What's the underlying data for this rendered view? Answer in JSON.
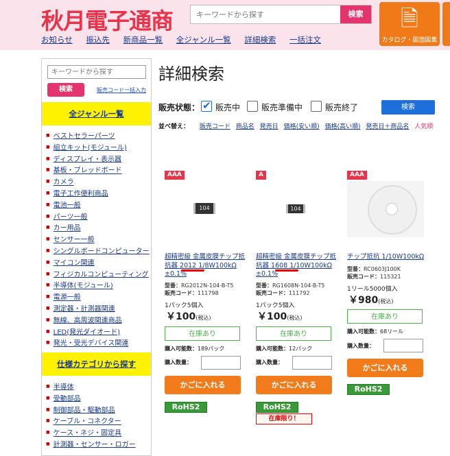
{
  "header": {
    "logo": "秋月電子通商",
    "search_placeholder": "キーワードから探す",
    "search_button": "検索",
    "catalog_label": "カタログ・図面図集",
    "nav": [
      "お知らせ",
      "振込先",
      "新商品一覧",
      "全ジャンル一覧",
      "詳細検索",
      "一括注文"
    ]
  },
  "sidebar": {
    "search_placeholder": "キーワードから探す",
    "search_button": "検索",
    "bulk_link": "販売コード一括入力",
    "genre_title": "全ジャンル一覧",
    "genres": [
      "ベストセラーパーツ",
      "組立キット(モジュール)",
      "ディスプレイ・表示器",
      "基板・ブレッドボード",
      "カメラ",
      "電子工作便利商品",
      "電池一般",
      "パーツ一般",
      "カー用品",
      "センサー一般",
      "シングルボードコンピューター",
      "マイコン関連",
      "フィジカルコンピューティング",
      "半導体(モジュール)",
      "電源一般",
      "測定器・計測器関連",
      "無線、高周波関連商品",
      "LED(発光ダイオード)",
      "発光・受光デバイス関連"
    ],
    "category_title": "仕様カテゴリから探す",
    "categories": [
      "半導体",
      "受動部品",
      "制御部品・駆動部品",
      "ケーブル・コネクター",
      "ケース・ネジ・固定具",
      "計測器・センサー・ロガー"
    ]
  },
  "main": {
    "title": "詳細検索",
    "status_label": "販売状態：",
    "status_options": [
      {
        "label": "販売中",
        "checked": true
      },
      {
        "label": "販売準備中",
        "checked": false
      },
      {
        "label": "販売終了",
        "checked": false
      }
    ],
    "search_button": "検索",
    "sort_label": "並べ替え：",
    "sort_options": [
      "販売コード",
      "商品名",
      "発売日",
      "価格(安い順)",
      "価格(高い順)",
      "発売日＋商品名",
      "人気順"
    ]
  },
  "products": [
    {
      "badge": "AAA",
      "chip_text": "104",
      "name": "超精密級 金属皮膜チップ抵抗器 2012 1/8W100kΩ ±0.1%",
      "model_label": "型番：",
      "model": "RG2012N-104-B-T5",
      "code_label": "販売コード：",
      "code": "111798",
      "pack": "1パック5個入",
      "price": "￥100",
      "tax": "(税込)",
      "stock": "在庫あり",
      "available_label": "購入可能数：",
      "available": "189パック",
      "qty_label": "購入数量：",
      "cart": "かごに入れる",
      "rohs": "RoHS2",
      "limited": ""
    },
    {
      "badge": "A",
      "chip_text": "104",
      "name": "超精密級 金属皮膜チップ抵抗器 1608 1/10W100kΩ ±0.1%",
      "model_label": "型番：",
      "model": "RG1608N-104-B-T5",
      "code_label": "販売コード：",
      "code": "111792",
      "pack": "1パック5個入",
      "price": "￥100",
      "tax": "(税込)",
      "stock": "在庫あり",
      "available_label": "購入可能数：",
      "available": "12パック",
      "qty_label": "購入数量：",
      "cart": "かごに入れる",
      "rohs": "RoHS2",
      "limited": "在庫限り！"
    },
    {
      "badge": "AAA",
      "chip_text": "",
      "name": "チップ抵抗 1/10W100kΩ",
      "model_label": "型番：",
      "model": "RC0603J100K",
      "code_label": "販売コード：",
      "code": "115321",
      "pack": "1リール5000個入",
      "price": "￥980",
      "tax": "(税込)",
      "stock": "在庫あり",
      "available_label": "購入可能数：",
      "available": "68リール",
      "qty_label": "購入数量：",
      "cart": "かごに入れる",
      "rohs": "RoHS2",
      "limited": ""
    }
  ],
  "colors": {
    "brand_red": "#e8334a",
    "pink": "#e4346e",
    "header_bg": "#fbe3ec",
    "yellow": "#fff200",
    "orange": "#f27b1b",
    "blue": "#1e6fd9",
    "green": "#4caf50"
  }
}
